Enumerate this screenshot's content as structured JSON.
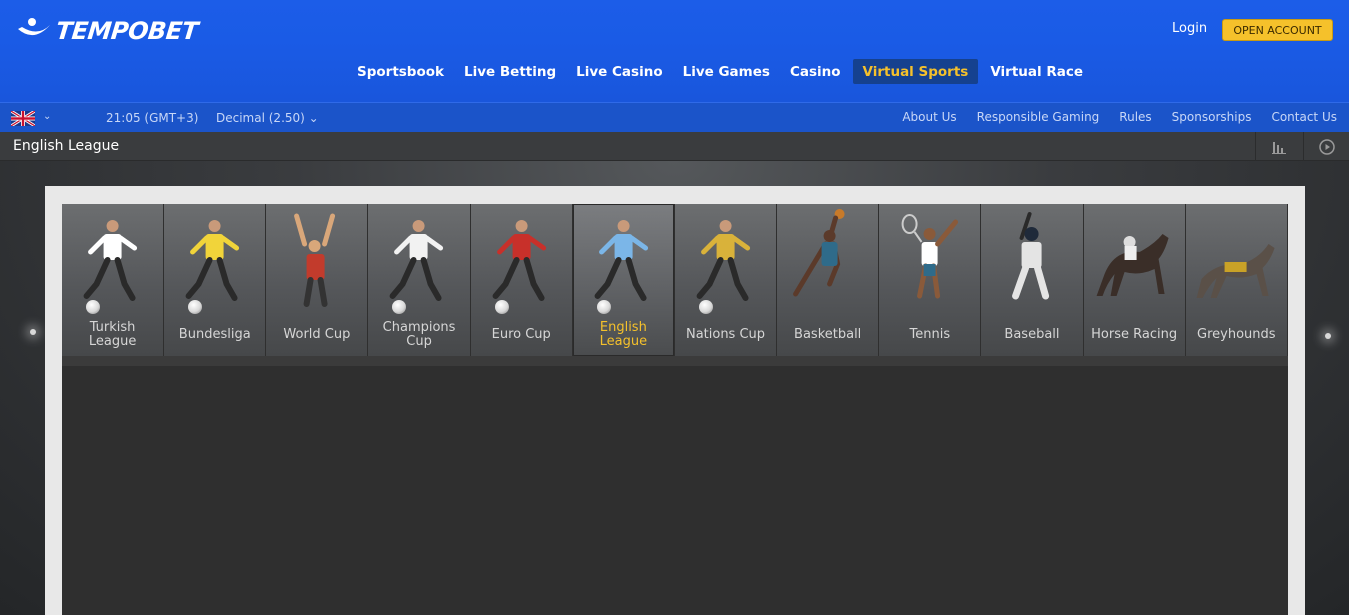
{
  "brand": {
    "name": "TEMPOBET",
    "accent": "#f5c12b",
    "header_blue": "#1a5be6"
  },
  "header": {
    "login_label": "Login",
    "open_account_label": "OPEN ACCOUNT",
    "nav": [
      {
        "label": "Sportsbook",
        "active": false
      },
      {
        "label": "Live Betting",
        "active": false
      },
      {
        "label": "Live Casino",
        "active": false
      },
      {
        "label": "Live Games",
        "active": false
      },
      {
        "label": "Casino",
        "active": false
      },
      {
        "label": "Virtual Sports",
        "active": true
      },
      {
        "label": "Virtual Race",
        "active": false
      }
    ]
  },
  "subbar": {
    "language_icon": "uk-flag-icon",
    "time": "21:05 (GMT+3)",
    "odds_format": "Decimal (2.50)",
    "links": [
      "About Us",
      "Responsible Gaming",
      "Rules",
      "Sponsorships",
      "Contact Us"
    ]
  },
  "titlebar": {
    "title": "English League",
    "icons": [
      "stats-icon",
      "play-icon"
    ]
  },
  "games": [
    {
      "label": "Turkish League",
      "icon": "football-player-icon",
      "color": "#ffffff",
      "active": false
    },
    {
      "label": "Bundesliga",
      "icon": "football-player-icon",
      "color": "#f1d43a",
      "active": false
    },
    {
      "label": "World Cup",
      "icon": "goalkeeper-icon",
      "color": "#c23b2c",
      "active": false
    },
    {
      "label": "Champions Cup",
      "icon": "football-player-icon",
      "color": "#f2f2f2",
      "active": false
    },
    {
      "label": "Euro Cup",
      "icon": "football-player-icon",
      "color": "#c8302a",
      "active": false
    },
    {
      "label": "English League",
      "icon": "football-player-icon",
      "color": "#7bb6e8",
      "active": true
    },
    {
      "label": "Nations Cup",
      "icon": "football-player-icon",
      "color": "#d9b23a",
      "active": false
    },
    {
      "label": "Basketball",
      "icon": "basketball-player-icon",
      "color": "#2f6b8a",
      "active": false
    },
    {
      "label": "Tennis",
      "icon": "tennis-player-icon",
      "color": "#ffffff",
      "active": false
    },
    {
      "label": "Baseball",
      "icon": "baseball-player-icon",
      "color": "#e4e4e4",
      "active": false
    },
    {
      "label": "Horse Racing",
      "icon": "horse-icon",
      "color": "#3a2e28",
      "active": false
    },
    {
      "label": "Greyhounds",
      "icon": "greyhound-icon",
      "color": "#5a5048",
      "active": false
    }
  ]
}
